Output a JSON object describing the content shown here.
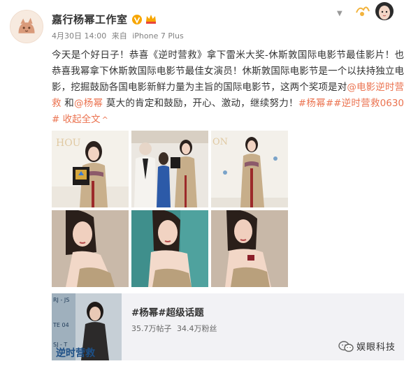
{
  "user": {
    "name": "嘉行杨幂工作室",
    "timestamp": "4月30日 14:00",
    "source_prefix": "来自",
    "device": "iPhone 7 Plus"
  },
  "post": {
    "segments": [
      {
        "text": "今天是个好日子！恭喜《逆时营救》拿下雷米大奖-休斯敦国际电影节最佳影片！也恭喜我幂拿下休斯敦国际电影节最佳女演员！休斯敦国际电影节是一个以扶持独立电影，挖掘鼓励各国电影新鲜力量为主旨的国际电影节，这两个奖项是对",
        "kind": "text"
      },
      {
        "text": "@电影逆时营救",
        "kind": "link"
      },
      {
        "text": " 和",
        "kind": "text"
      },
      {
        "text": "@杨幂",
        "kind": "link"
      },
      {
        "text": " 莫大的肯定和鼓励，开心、激动，继续努力！",
        "kind": "text"
      },
      {
        "text": "#杨幂##逆时营救0630#",
        "kind": "link"
      }
    ],
    "collapse_label": "收起全文",
    "collapse_arrow": "^"
  },
  "photos": [
    {
      "scene": "award-holding",
      "bg": "#f4f1ea"
    },
    {
      "scene": "award-ceremony",
      "bg": "#ebe7e1"
    },
    {
      "scene": "pose-floral",
      "bg": "#f3f0ea"
    },
    {
      "scene": "closeup-left",
      "bg": "#c9b9a9"
    },
    {
      "scene": "closeup-teal",
      "bg": "#3f8f8c"
    },
    {
      "scene": "closeup-right",
      "bg": "#c8b8a8"
    }
  ],
  "card": {
    "title": "#杨幂#超级话题",
    "posts": "35.7万帖子",
    "fans": "34.4万粉丝",
    "thumb_caption": "逆时营救",
    "thumb_labels": [
      "RJ - JS",
      "TE 04",
      "SJ - T"
    ]
  },
  "watermark": {
    "text": "娱眼科技"
  },
  "colors": {
    "link": "#eb7350",
    "verified": "#f7a600",
    "text": "#333333",
    "meta": "#808080"
  },
  "icons": {
    "verified": "v-badge-icon",
    "vip": "vip-crown-icon",
    "chevron": "chevron-down-icon",
    "watermark": "wechat-icon"
  }
}
